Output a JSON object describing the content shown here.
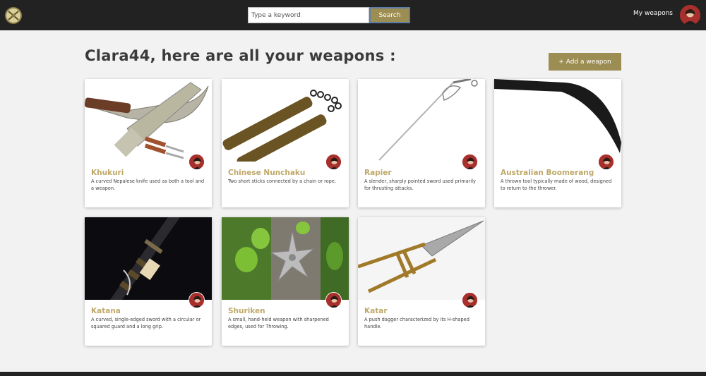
{
  "navbar": {
    "logo_icon": "crossed-swords-logo-icon",
    "search": {
      "placeholder": "Type a keyword",
      "value": "",
      "button_label": "Search"
    },
    "my_weapons_label": "My weapons",
    "avatar_icon": "user-avatar"
  },
  "main": {
    "title": "Clara44, here are all your weapons :",
    "add_button_label": "+ Add a weapon"
  },
  "colors": {
    "navbar_bg": "#222222",
    "accent": "#9c8d52",
    "weapon_name": "#bfa869",
    "page_bg": "#f2f2f2"
  },
  "weapons": [
    {
      "name": "Khukuri",
      "description": "A curved Nepalese knife used as both a tool and a weapon.",
      "image_icon": "khukuri-image"
    },
    {
      "name": "Chinese Nunchaku",
      "description": "Two short sticks connected by a chain or rope.",
      "image_icon": "nunchaku-image"
    },
    {
      "name": "Rapier",
      "description": "A slender, sharply pointed sword used primarily for thrusting attacks.",
      "image_icon": "rapier-image"
    },
    {
      "name": "Australian Boomerang",
      "description": "A thrown tool typically made of wood, designed to return to the thrower.",
      "image_icon": "boomerang-image"
    },
    {
      "name": "Katana",
      "description": "A curved, single-edged sword with a circular or squared guard and a long grip.",
      "image_icon": "katana-image"
    },
    {
      "name": "Shuriken",
      "description": "A small, hand-held weapon with sharpened edges, used for Throwing.",
      "image_icon": "shuriken-image"
    },
    {
      "name": "Katar",
      "description": "A push dagger characterized by its H-shaped handle.",
      "image_icon": "katar-image"
    }
  ]
}
